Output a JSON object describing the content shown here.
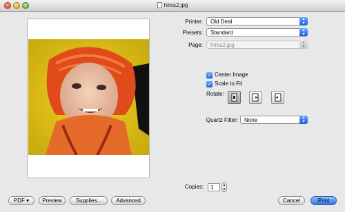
{
  "window": {
    "title": "hires2.jpg"
  },
  "printer": {
    "label": "Printer:",
    "value": "Old Deal"
  },
  "presets": {
    "label": "Presets:",
    "value": "Standard"
  },
  "page": {
    "label": "Page:",
    "value": "hires2.jpg"
  },
  "options": {
    "center_image": "Center Image",
    "scale_to_fit": "Scale to Fit",
    "rotate_label": "Rotate:"
  },
  "quartz": {
    "label": "Quartz Filter:",
    "value": "None"
  },
  "copies": {
    "label": "Copies:",
    "value": "1"
  },
  "buttons": {
    "pdf": "PDF ▾",
    "preview": "Preview",
    "supplies": "Supplies...",
    "advanced": "Advanced",
    "cancel": "Cancel",
    "print": "Print"
  },
  "colors": {
    "accent": "#2f74e2",
    "checkbox": "#1a5fd8"
  },
  "icons": [
    "close-icon",
    "minimize-icon",
    "zoom-icon",
    "document-icon",
    "rotate-portrait-icon",
    "rotate-left-icon",
    "rotate-right-icon",
    "popup-arrows-icon",
    "stepper-icon"
  ]
}
